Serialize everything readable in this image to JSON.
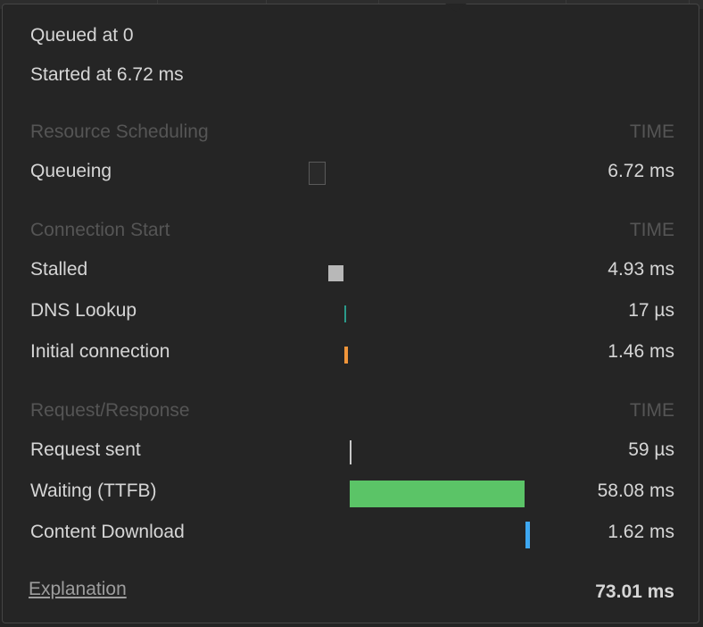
{
  "summary": {
    "queued": "Queued at 0",
    "started": "Started at 6.72 ms"
  },
  "sections": [
    {
      "header": "Resource Scheduling",
      "time_header": "TIME",
      "rows": [
        {
          "label": "Queueing",
          "value": "6.72 ms"
        }
      ]
    },
    {
      "header": "Connection Start",
      "time_header": "TIME",
      "rows": [
        {
          "label": "Stalled",
          "value": "4.93 ms"
        },
        {
          "label": "DNS Lookup",
          "value": "17 µs"
        },
        {
          "label": "Initial connection",
          "value": "1.46 ms"
        }
      ]
    },
    {
      "header": "Request/Response",
      "time_header": "TIME",
      "rows": [
        {
          "label": "Request sent",
          "value": "59 µs"
        },
        {
          "label": "Waiting (TTFB)",
          "value": "58.08 ms"
        },
        {
          "label": "Content Download",
          "value": "1.62 ms"
        }
      ]
    }
  ],
  "footer": {
    "explanation_link": "Explanation",
    "total": "73.01 ms"
  },
  "colors": {
    "queueing": "#2a2a2a",
    "stalled": "#b8b8b8",
    "dns": "#2b9a8a",
    "initial_connection": "#f0953a",
    "request_sent": "#c8c8c8",
    "waiting": "#5bc467",
    "content_download": "#3ea8f2"
  }
}
